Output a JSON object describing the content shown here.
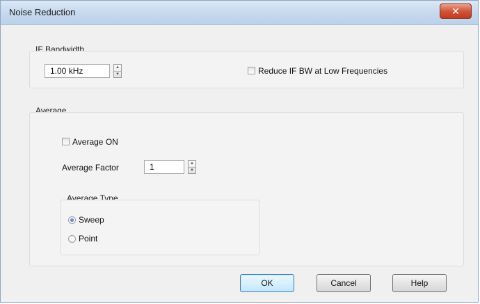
{
  "window": {
    "title": "Noise Reduction",
    "close_glyph": "✕"
  },
  "if_bandwidth": {
    "group_label": "IF Bandwidth",
    "value": "1.00 kHz",
    "reduce_checkbox_label": "Reduce IF BW at Low Frequencies",
    "reduce_checked": false
  },
  "average": {
    "group_label": "Average",
    "average_on_label": "Average ON",
    "average_on_checked": false,
    "factor_label": "Average Factor",
    "factor_value": "1",
    "type": {
      "group_label": "Average Type",
      "options": [
        {
          "label": "Sweep",
          "checked": true
        },
        {
          "label": "Point",
          "checked": false
        }
      ]
    }
  },
  "buttons": {
    "ok": "OK",
    "cancel": "Cancel",
    "help": "Help"
  },
  "spinner_glyphs": {
    "up": "▲",
    "down": "▼"
  },
  "colors": {
    "titlebar": "#c6d8ee",
    "close_button": "#d2553a",
    "default_button_border": "#3c7fb1",
    "radio_selected": "#2a62b8"
  }
}
